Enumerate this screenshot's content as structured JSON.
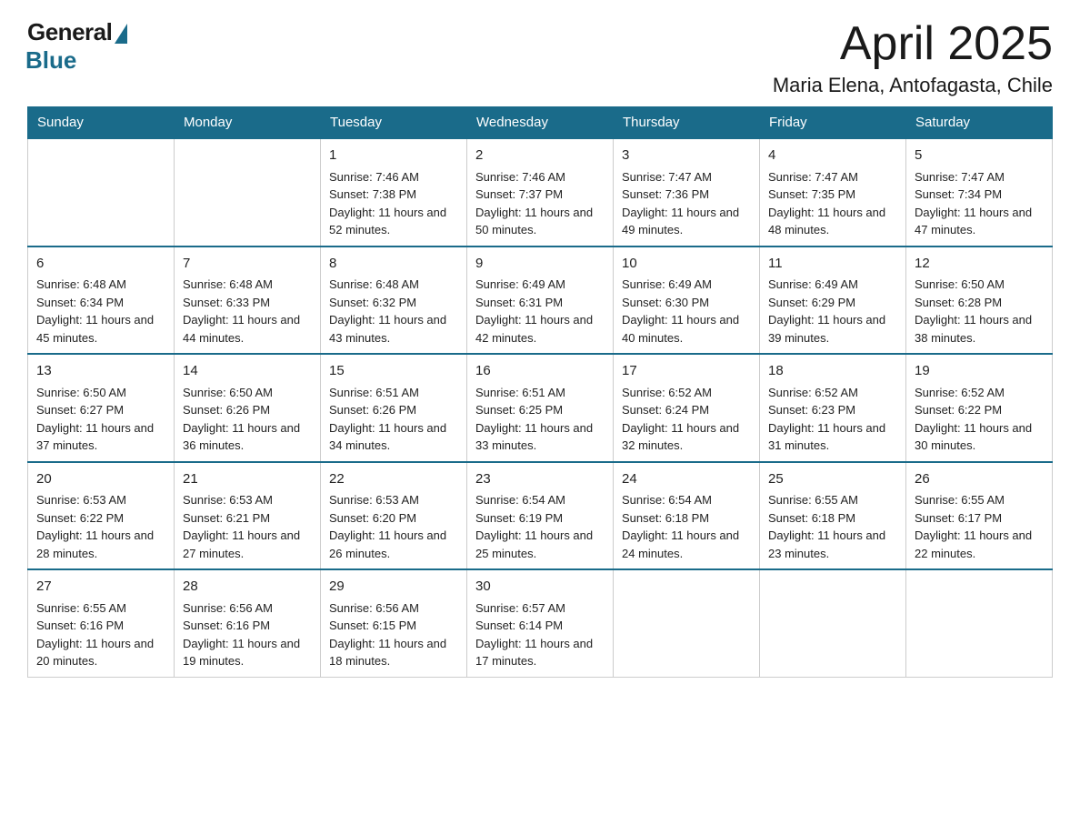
{
  "header": {
    "logo_general": "General",
    "logo_blue": "Blue",
    "month_title": "April 2025",
    "location": "Maria Elena, Antofagasta, Chile"
  },
  "days_of_week": [
    "Sunday",
    "Monday",
    "Tuesday",
    "Wednesday",
    "Thursday",
    "Friday",
    "Saturday"
  ],
  "weeks": [
    [
      {
        "day": "",
        "sunrise": "",
        "sunset": "",
        "daylight": ""
      },
      {
        "day": "",
        "sunrise": "",
        "sunset": "",
        "daylight": ""
      },
      {
        "day": "1",
        "sunrise": "Sunrise: 7:46 AM",
        "sunset": "Sunset: 7:38 PM",
        "daylight": "Daylight: 11 hours and 52 minutes."
      },
      {
        "day": "2",
        "sunrise": "Sunrise: 7:46 AM",
        "sunset": "Sunset: 7:37 PM",
        "daylight": "Daylight: 11 hours and 50 minutes."
      },
      {
        "day": "3",
        "sunrise": "Sunrise: 7:47 AM",
        "sunset": "Sunset: 7:36 PM",
        "daylight": "Daylight: 11 hours and 49 minutes."
      },
      {
        "day": "4",
        "sunrise": "Sunrise: 7:47 AM",
        "sunset": "Sunset: 7:35 PM",
        "daylight": "Daylight: 11 hours and 48 minutes."
      },
      {
        "day": "5",
        "sunrise": "Sunrise: 7:47 AM",
        "sunset": "Sunset: 7:34 PM",
        "daylight": "Daylight: 11 hours and 47 minutes."
      }
    ],
    [
      {
        "day": "6",
        "sunrise": "Sunrise: 6:48 AM",
        "sunset": "Sunset: 6:34 PM",
        "daylight": "Daylight: 11 hours and 45 minutes."
      },
      {
        "day": "7",
        "sunrise": "Sunrise: 6:48 AM",
        "sunset": "Sunset: 6:33 PM",
        "daylight": "Daylight: 11 hours and 44 minutes."
      },
      {
        "day": "8",
        "sunrise": "Sunrise: 6:48 AM",
        "sunset": "Sunset: 6:32 PM",
        "daylight": "Daylight: 11 hours and 43 minutes."
      },
      {
        "day": "9",
        "sunrise": "Sunrise: 6:49 AM",
        "sunset": "Sunset: 6:31 PM",
        "daylight": "Daylight: 11 hours and 42 minutes."
      },
      {
        "day": "10",
        "sunrise": "Sunrise: 6:49 AM",
        "sunset": "Sunset: 6:30 PM",
        "daylight": "Daylight: 11 hours and 40 minutes."
      },
      {
        "day": "11",
        "sunrise": "Sunrise: 6:49 AM",
        "sunset": "Sunset: 6:29 PM",
        "daylight": "Daylight: 11 hours and 39 minutes."
      },
      {
        "day": "12",
        "sunrise": "Sunrise: 6:50 AM",
        "sunset": "Sunset: 6:28 PM",
        "daylight": "Daylight: 11 hours and 38 minutes."
      }
    ],
    [
      {
        "day": "13",
        "sunrise": "Sunrise: 6:50 AM",
        "sunset": "Sunset: 6:27 PM",
        "daylight": "Daylight: 11 hours and 37 minutes."
      },
      {
        "day": "14",
        "sunrise": "Sunrise: 6:50 AM",
        "sunset": "Sunset: 6:26 PM",
        "daylight": "Daylight: 11 hours and 36 minutes."
      },
      {
        "day": "15",
        "sunrise": "Sunrise: 6:51 AM",
        "sunset": "Sunset: 6:26 PM",
        "daylight": "Daylight: 11 hours and 34 minutes."
      },
      {
        "day": "16",
        "sunrise": "Sunrise: 6:51 AM",
        "sunset": "Sunset: 6:25 PM",
        "daylight": "Daylight: 11 hours and 33 minutes."
      },
      {
        "day": "17",
        "sunrise": "Sunrise: 6:52 AM",
        "sunset": "Sunset: 6:24 PM",
        "daylight": "Daylight: 11 hours and 32 minutes."
      },
      {
        "day": "18",
        "sunrise": "Sunrise: 6:52 AM",
        "sunset": "Sunset: 6:23 PM",
        "daylight": "Daylight: 11 hours and 31 minutes."
      },
      {
        "day": "19",
        "sunrise": "Sunrise: 6:52 AM",
        "sunset": "Sunset: 6:22 PM",
        "daylight": "Daylight: 11 hours and 30 minutes."
      }
    ],
    [
      {
        "day": "20",
        "sunrise": "Sunrise: 6:53 AM",
        "sunset": "Sunset: 6:22 PM",
        "daylight": "Daylight: 11 hours and 28 minutes."
      },
      {
        "day": "21",
        "sunrise": "Sunrise: 6:53 AM",
        "sunset": "Sunset: 6:21 PM",
        "daylight": "Daylight: 11 hours and 27 minutes."
      },
      {
        "day": "22",
        "sunrise": "Sunrise: 6:53 AM",
        "sunset": "Sunset: 6:20 PM",
        "daylight": "Daylight: 11 hours and 26 minutes."
      },
      {
        "day": "23",
        "sunrise": "Sunrise: 6:54 AM",
        "sunset": "Sunset: 6:19 PM",
        "daylight": "Daylight: 11 hours and 25 minutes."
      },
      {
        "day": "24",
        "sunrise": "Sunrise: 6:54 AM",
        "sunset": "Sunset: 6:18 PM",
        "daylight": "Daylight: 11 hours and 24 minutes."
      },
      {
        "day": "25",
        "sunrise": "Sunrise: 6:55 AM",
        "sunset": "Sunset: 6:18 PM",
        "daylight": "Daylight: 11 hours and 23 minutes."
      },
      {
        "day": "26",
        "sunrise": "Sunrise: 6:55 AM",
        "sunset": "Sunset: 6:17 PM",
        "daylight": "Daylight: 11 hours and 22 minutes."
      }
    ],
    [
      {
        "day": "27",
        "sunrise": "Sunrise: 6:55 AM",
        "sunset": "Sunset: 6:16 PM",
        "daylight": "Daylight: 11 hours and 20 minutes."
      },
      {
        "day": "28",
        "sunrise": "Sunrise: 6:56 AM",
        "sunset": "Sunset: 6:16 PM",
        "daylight": "Daylight: 11 hours and 19 minutes."
      },
      {
        "day": "29",
        "sunrise": "Sunrise: 6:56 AM",
        "sunset": "Sunset: 6:15 PM",
        "daylight": "Daylight: 11 hours and 18 minutes."
      },
      {
        "day": "30",
        "sunrise": "Sunrise: 6:57 AM",
        "sunset": "Sunset: 6:14 PM",
        "daylight": "Daylight: 11 hours and 17 minutes."
      },
      {
        "day": "",
        "sunrise": "",
        "sunset": "",
        "daylight": ""
      },
      {
        "day": "",
        "sunrise": "",
        "sunset": "",
        "daylight": ""
      },
      {
        "day": "",
        "sunrise": "",
        "sunset": "",
        "daylight": ""
      }
    ]
  ]
}
